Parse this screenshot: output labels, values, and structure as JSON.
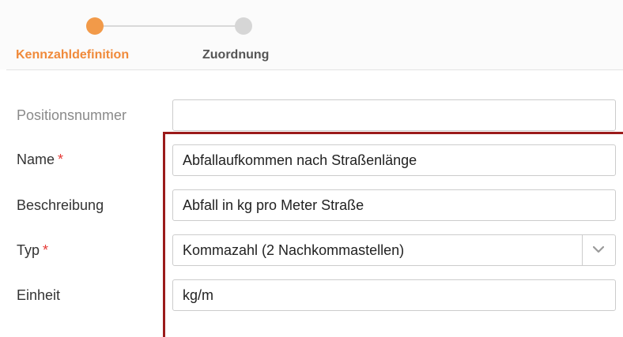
{
  "stepper": {
    "steps": [
      {
        "label": "Kennzahldefinition",
        "active": true
      },
      {
        "label": "Zuordnung",
        "active": false
      }
    ],
    "active_color": "#f29a49",
    "inactive_color": "#d6d6d6"
  },
  "form": {
    "positionsnummer": {
      "label": "Positionsnummer",
      "value": ""
    },
    "name": {
      "label": "Name",
      "required_marker": "*",
      "value": "Abfallaufkommen nach Straßenlänge"
    },
    "beschreibung": {
      "label": "Beschreibung",
      "value": "Abfall in kg pro Meter Straße"
    },
    "typ": {
      "label": "Typ",
      "required_marker": "*",
      "value": "Kommazahl (2 Nachkommastellen)"
    },
    "einheit": {
      "label": "Einheit",
      "value": "kg/m"
    }
  },
  "highlight_color": "#9b1b1b",
  "icons": {
    "typ_dropdown": "chevron-down-icon"
  }
}
